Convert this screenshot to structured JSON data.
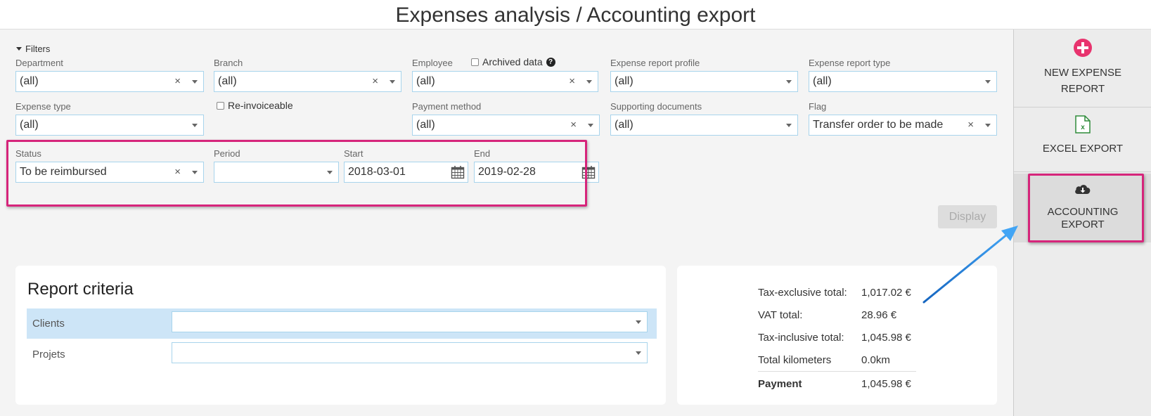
{
  "page": {
    "title": "Expenses analysis / Accounting export"
  },
  "filters": {
    "toggle_label": "Filters",
    "department": {
      "label": "Department",
      "value": "(all)"
    },
    "branch": {
      "label": "Branch",
      "value": "(all)"
    },
    "employee": {
      "label": "Employee",
      "value": "(all)"
    },
    "archived_data": {
      "label": "Archived data",
      "checked": false
    },
    "expense_report_profile": {
      "label": "Expense report profile",
      "value": "(all)"
    },
    "expense_report_type": {
      "label": "Expense report type",
      "value": "(all)"
    },
    "expense_type": {
      "label": "Expense type",
      "value": "(all)"
    },
    "reinvoiceable": {
      "label": "Re-invoiceable",
      "checked": false
    },
    "payment_method": {
      "label": "Payment method",
      "value": "(all)"
    },
    "supporting_documents": {
      "label": "Supporting documents",
      "value": "(all)"
    },
    "flag": {
      "label": "Flag",
      "value": "Transfer order to be made"
    },
    "status": {
      "label": "Status",
      "value": "To be reimbursed"
    },
    "period": {
      "label": "Period",
      "value": ""
    },
    "start": {
      "label": "Start",
      "value": "2018-03-01"
    },
    "end": {
      "label": "End",
      "value": "2019-02-28"
    },
    "clear_glyph": "×",
    "display_button": "Display"
  },
  "report_criteria": {
    "title": "Report criteria",
    "rows": [
      {
        "label": "Clients",
        "value": ""
      },
      {
        "label": "Projets",
        "value": ""
      }
    ]
  },
  "totals": {
    "rows": [
      {
        "label": "Tax-exclusive total:",
        "value": "1,017.02 €"
      },
      {
        "label": "VAT total:",
        "value": "28.96 €"
      },
      {
        "label": "Tax-inclusive total:",
        "value": "1,045.98 €"
      },
      {
        "label": "Total kilometers",
        "value": "0.0km"
      },
      {
        "label": "Payment",
        "value": "1,045.98 €"
      }
    ]
  },
  "sidebar": {
    "new_expense_report": {
      "line1": "NEW EXPENSE",
      "line2": "REPORT",
      "icon": "plus-circle-icon"
    },
    "excel_export": {
      "label": "EXCEL EXPORT",
      "icon": "excel-file-icon"
    },
    "accounting_export": {
      "line1": "ACCOUNTING",
      "line2": "EXPORT",
      "icon": "cloud-download-icon"
    }
  },
  "colors": {
    "highlight": "#d6257b",
    "accent_plus": "#e8336e",
    "excel_green": "#2e8b3a",
    "arrow_blue": "#1e88e5"
  }
}
